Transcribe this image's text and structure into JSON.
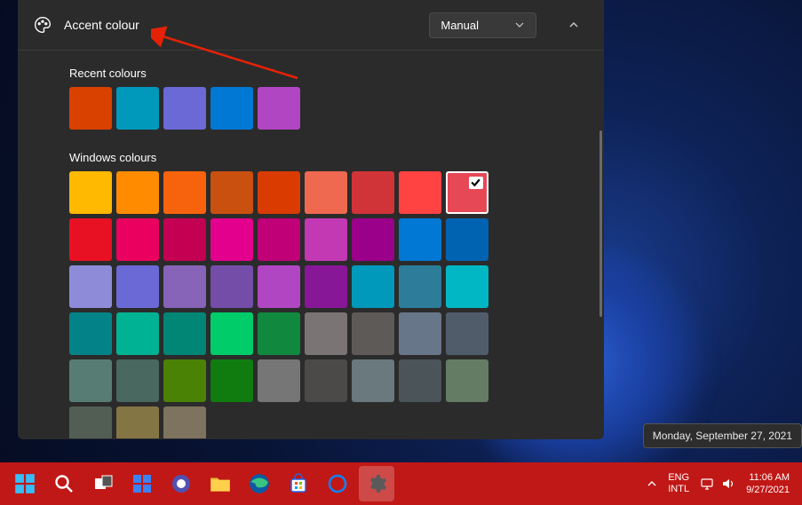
{
  "header": {
    "title": "Accent colour",
    "dropdown_value": "Manual"
  },
  "recent": {
    "label": "Recent colours",
    "colors": [
      "#d94100",
      "#0099bc",
      "#6b69d6",
      "#0078d4",
      "#b146c2"
    ]
  },
  "windows_colours": {
    "label": "Windows colours",
    "colors": [
      "#ffb900",
      "#ff8c00",
      "#f7630c",
      "#ca5010",
      "#da3b01",
      "#ef6950",
      "#d13438",
      "#ff4343",
      "#e74856",
      "#e81123",
      "#ea005e",
      "#c30052",
      "#e3008c",
      "#bf0077",
      "#c239b3",
      "#9a0089",
      "#0078d4",
      "#0063b1",
      "#8e8cd8",
      "#6b69d6",
      "#8764b8",
      "#744da9",
      "#b146c2",
      "#881798",
      "#0099bc",
      "#2d7d9a",
      "#00b7c3",
      "#038387",
      "#00b294",
      "#018574",
      "#00cc6a",
      "#10893e",
      "#7a7574",
      "#5d5a58",
      "#68768a",
      "#515c6b",
      "#567c73",
      "#486860",
      "#498205",
      "#107c10",
      "#767676",
      "#4c4a48",
      "#69797e",
      "#4a5459",
      "#647c64",
      "#525e54",
      "#847545",
      "#7e735f"
    ],
    "selected_index": 8
  },
  "tooltip": {
    "date": "Monday, September 27, 2021"
  },
  "taskbar": {
    "lang_top": "ENG",
    "lang_bottom": "INTL",
    "time": "11:06 AM",
    "date": "9/27/2021"
  }
}
